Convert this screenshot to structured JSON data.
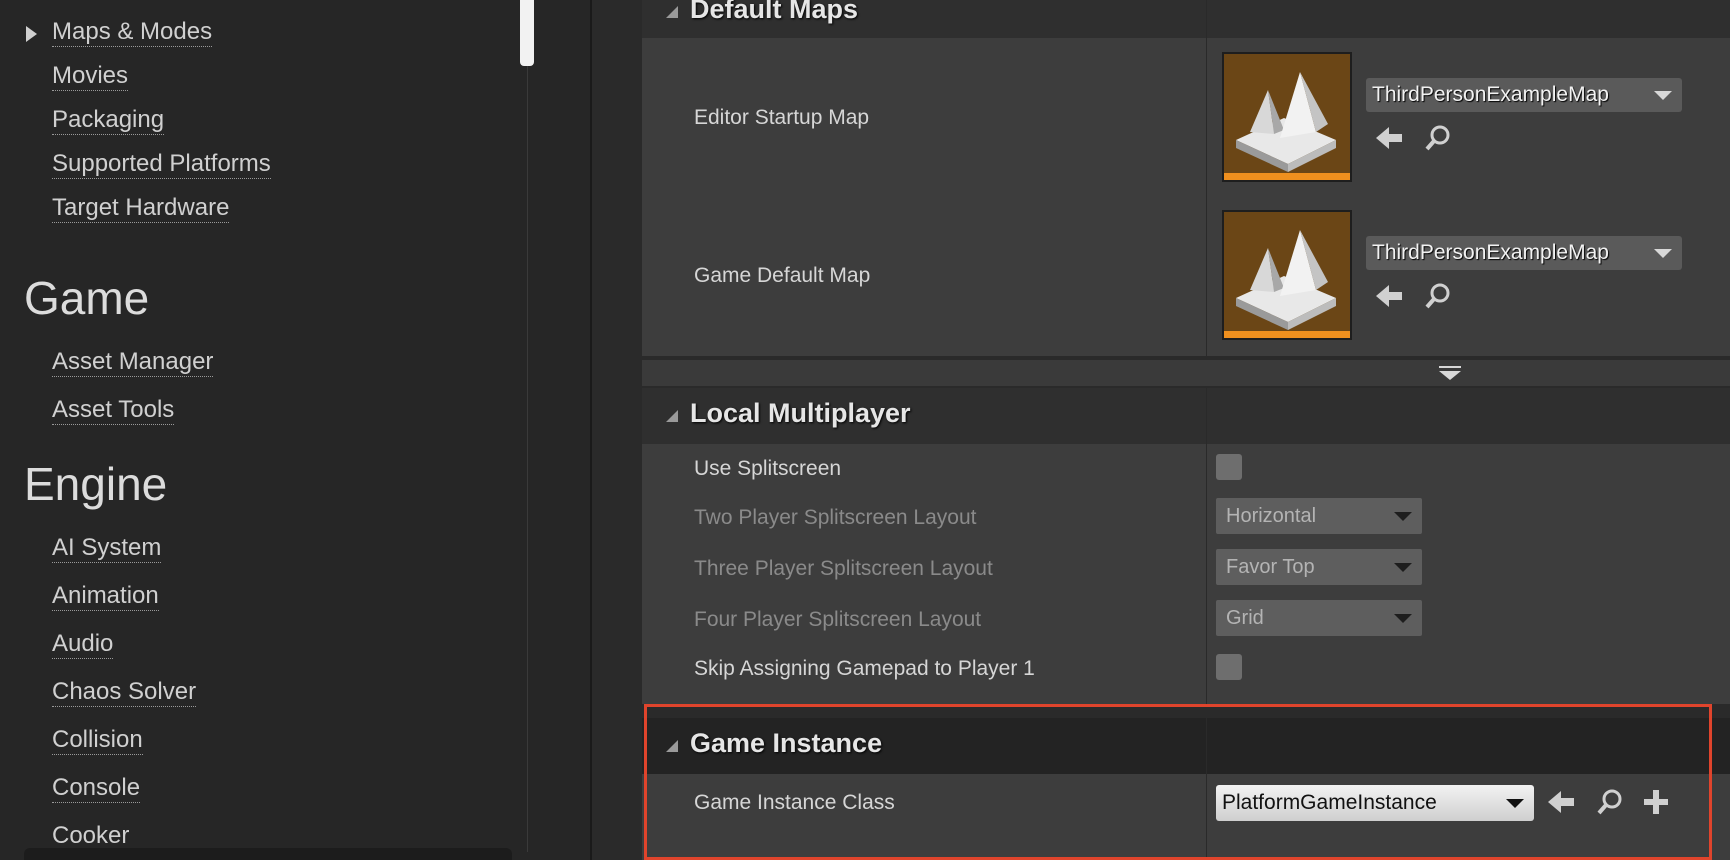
{
  "nav": {
    "items_top": [
      "Maps & Modes",
      "Movies",
      "Packaging",
      "Supported Platforms",
      "Target Hardware"
    ],
    "game_heading": "Game",
    "game_items": [
      "Asset Manager",
      "Asset Tools"
    ],
    "engine_heading": "Engine",
    "engine_items": [
      "AI System",
      "Animation",
      "Audio",
      "Chaos Solver",
      "Collision",
      "Console",
      "Cooker"
    ]
  },
  "sections": {
    "default_maps": {
      "title": "Default Maps",
      "editor_startup_map_label": "Editor Startup Map",
      "editor_startup_map_value": "ThirdPersonExampleMap",
      "game_default_map_label": "Game Default Map",
      "game_default_map_value": "ThirdPersonExampleMap"
    },
    "local_multiplayer": {
      "title": "Local Multiplayer",
      "use_splitscreen_label": "Use Splitscreen",
      "use_splitscreen_checked": false,
      "two_player_label": "Two Player Splitscreen Layout",
      "two_player_value": "Horizontal",
      "three_player_label": "Three Player Splitscreen Layout",
      "three_player_value": "Favor Top",
      "four_player_label": "Four Player Splitscreen Layout",
      "four_player_value": "Grid",
      "skip_gamepad_label": "Skip Assigning Gamepad to Player 1",
      "skip_gamepad_checked": false
    },
    "game_instance": {
      "title": "Game Instance",
      "class_label": "Game Instance Class",
      "class_value": "PlatformGameInstance"
    }
  },
  "colors": {
    "highlight": "#e0442c",
    "thumbnail_accent": "#f0901e"
  },
  "icons": [
    "expand-arrow-icon",
    "use-selected-arrow-icon",
    "browse-search-icon",
    "add-plus-icon",
    "dropdown-caret-icon",
    "advanced-expand-icon"
  ]
}
